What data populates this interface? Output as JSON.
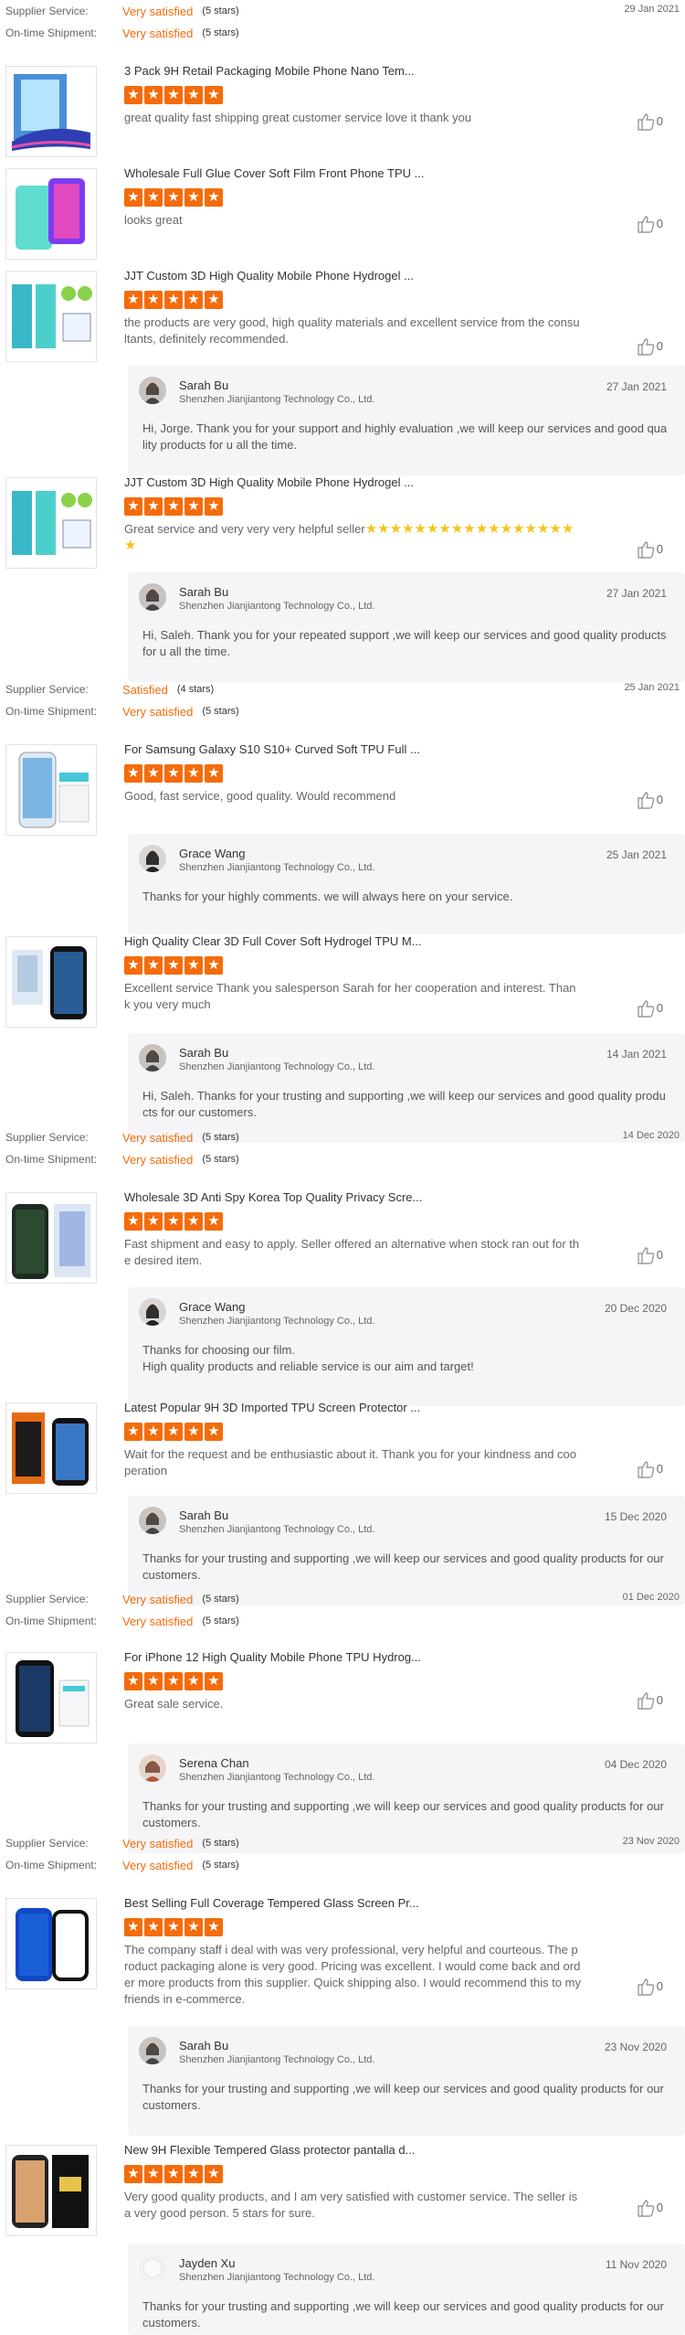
{
  "labels": {
    "supplier_service": "Supplier Service:",
    "on_time_shipment": "On-time Shipment:"
  },
  "groups": [
    {
      "supplier": {
        "value": "Very satisfied",
        "stars": "(5 stars)"
      },
      "shipment": {
        "value": "Very satisfied",
        "stars": "(5 stars)"
      },
      "date": "29 Jan 2021",
      "reviews": [
        {
          "title": "3 Pack 9H Retail Packaging Mobile Phone Nano Tem...",
          "comment": "great quality fast shipping great customer service love it thank you",
          "likes": "0"
        },
        {
          "title": "Wholesale Full Glue Cover Soft Film Front Phone TPU ...",
          "comment": "looks great",
          "likes": "0"
        },
        {
          "title": "JJT Custom 3D High Quality Mobile Phone Hydrogel ...",
          "comment": "the products are very good, high quality materials and excellent service from the consultants, definitely recommended.",
          "likes": "0",
          "reply": {
            "name": "Sarah Bu",
            "company": "Shenzhen Jianjiantong Technology Co., Ltd.",
            "date": "27 Jan 2021",
            "text": "Hi, Jorge. Thank you for your support and highly evaluation ,we will keep our services and good quality products for u all the time."
          }
        },
        {
          "title": "JJT Custom 3D High Quality Mobile Phone Hydrogel ...",
          "comment": "Great service and very very very helpful seller",
          "inline_stars": "★★★★★★★★★★★★★★★★★★",
          "likes": "0",
          "reply": {
            "name": "Sarah Bu",
            "company": "Shenzhen Jianjiantong Technology Co., Ltd.",
            "date": "27 Jan 2021",
            "text": "Hi, Saleh. Thank you for your repeated support ,we will keep our services and good quality products for u all the time."
          }
        }
      ]
    },
    {
      "supplier": {
        "value": "Satisfied",
        "stars": "(4 stars)"
      },
      "shipment": {
        "value": "Very satisfied",
        "stars": "(5 stars)"
      },
      "date": "25 Jan 2021",
      "reviews": [
        {
          "title": "For Samsung Galaxy S10 S10+ Curved Soft TPU Full ...",
          "comment": "Good, fast service, good quality. Would recommend",
          "likes": "0",
          "reply": {
            "name": "Grace Wang",
            "company": "Shenzhen Jianjiantong Technology Co., Ltd.",
            "date": "25 Jan 2021",
            "text": "Thanks for your highly comments. we will always here on your service."
          }
        },
        {
          "title": "High Quality Clear 3D Full Cover Soft Hydrogel TPU M...",
          "comment": "Excellent service Thank you salesperson Sarah for her cooperation and interest. Thank you very much",
          "likes": "0",
          "reply": {
            "name": "Sarah Bu",
            "company": "Shenzhen Jianjiantong Technology Co., Ltd.",
            "date": "14 Jan 2021",
            "text": "Hi, Saleh. Thanks for your trusting  and supporting ,we will keep our services and good quality products for our customers."
          }
        }
      ]
    },
    {
      "supplier": {
        "value": "Very satisfied",
        "stars": "(5 stars)"
      },
      "shipment": {
        "value": "Very satisfied",
        "stars": "(5 stars)"
      },
      "date": "14 Dec 2020",
      "reviews": [
        {
          "title": "Wholesale 3D Anti Spy Korea Top Quality Privacy Scre...",
          "comment": "Fast shipment and easy to apply. Seller offered an alternative when stock ran out for the desired item.",
          "likes": "0",
          "reply": {
            "name": "Grace Wang",
            "company": "Shenzhen Jianjiantong Technology Co., Ltd.",
            "date": "20 Dec 2020",
            "text": "Thanks for choosing our film.\nHigh quality products and reliable service is our aim and target!"
          }
        },
        {
          "title": "Latest Popular 9H 3D Imported TPU Screen Protector ...",
          "comment": "Wait for the request and be enthusiastic about it. Thank you for your kindness and cooperation",
          "likes": "0",
          "reply": {
            "name": "Sarah Bu",
            "company": "Shenzhen Jianjiantong Technology Co., Ltd.",
            "date": "15 Dec 2020",
            "text": "Thanks for your trusting  and supporting ,we will keep our services and good quality products for our customers."
          }
        }
      ]
    },
    {
      "supplier": {
        "value": "Very satisfied",
        "stars": "(5 stars)"
      },
      "shipment": {
        "value": "Very satisfied",
        "stars": "(5 stars)"
      },
      "date": "01 Dec 2020",
      "reviews": [
        {
          "title": "For iPhone 12 High Quality Mobile Phone TPU Hydrog...",
          "comment": "Great sale service.",
          "likes": "0",
          "reply": {
            "name": "Serena Chan",
            "company": "Shenzhen Jianjiantong Technology Co., Ltd.",
            "date": "04 Dec 2020",
            "text": "Thanks for your trusting  and supporting ,we will keep our services and good quality products for our customers."
          }
        }
      ]
    },
    {
      "supplier": {
        "value": "Very satisfied",
        "stars": "(5 stars)"
      },
      "shipment": {
        "value": "Very satisfied",
        "stars": "(5 stars)"
      },
      "date": "23 Nov 2020",
      "reviews": [
        {
          "title": "Best Selling Full Coverage Tempered Glass Screen Pr...",
          "comment": "The company staff i deal with was very professional, very helpful and courteous. The product packaging alone is very good. Pricing was excellent. I would come back and order more products from this supplier. Quick shipping also. I would recommend this to my friends in e-commerce.",
          "likes": "0",
          "reply": {
            "name": "Sarah Bu",
            "company": "Shenzhen Jianjiantong Technology Co., Ltd.",
            "date": "23 Nov 2020",
            "text": "Thanks for your trusting  and supporting ,we will keep our services and good quality products for our customers."
          }
        },
        {
          "title": "New 9H Flexible Tempered Glass protector pantalla d...",
          "comment": "Very good quality products, and I am very satisfied with customer service. The seller is a very good person. 5 stars for sure.",
          "likes": "0",
          "reply": {
            "name": "Jayden Xu",
            "company": "Shenzhen Jianjiantong Technology Co., Ltd.",
            "date": "11 Nov 2020",
            "text": "Thanks for your trusting  and supporting ,we will keep our services and good quality products for our customers."
          }
        }
      ]
    }
  ]
}
